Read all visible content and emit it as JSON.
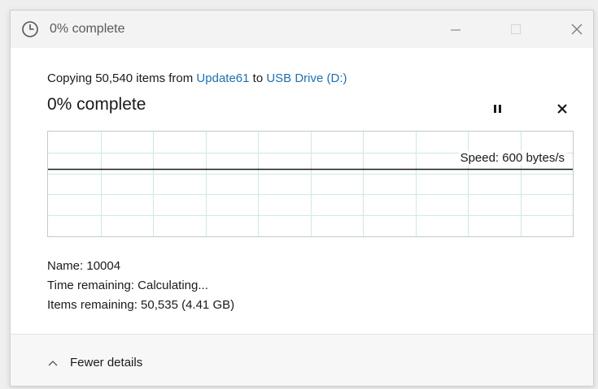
{
  "window": {
    "title": "0% complete",
    "icon": "clock-icon",
    "controls": {
      "minimize": "minimize-icon",
      "maximize": "maximize-icon",
      "close": "close-icon"
    }
  },
  "copy": {
    "prefix": "Copying 50,540 items from ",
    "source": "Update61",
    "middle": " to ",
    "destination": "USB Drive (D:)",
    "percent_text": "0% complete",
    "progress": 0.0
  },
  "graph": {
    "speed_label": "Speed: 600 bytes/s",
    "grid_color": "#cfe8e4",
    "line_color": "#1a1a1a"
  },
  "details": {
    "name": "Name: 10004",
    "time_remaining": "Time remaining: Calculating...",
    "items_remaining": "Items remaining: 50,535 (4.41 GB)"
  },
  "footer": {
    "toggle_label": "Fewer details",
    "toggle_icon": "chevron-up-icon"
  },
  "colors": {
    "link": "#1f6fb0",
    "titlebar": "#f3f3f3"
  }
}
